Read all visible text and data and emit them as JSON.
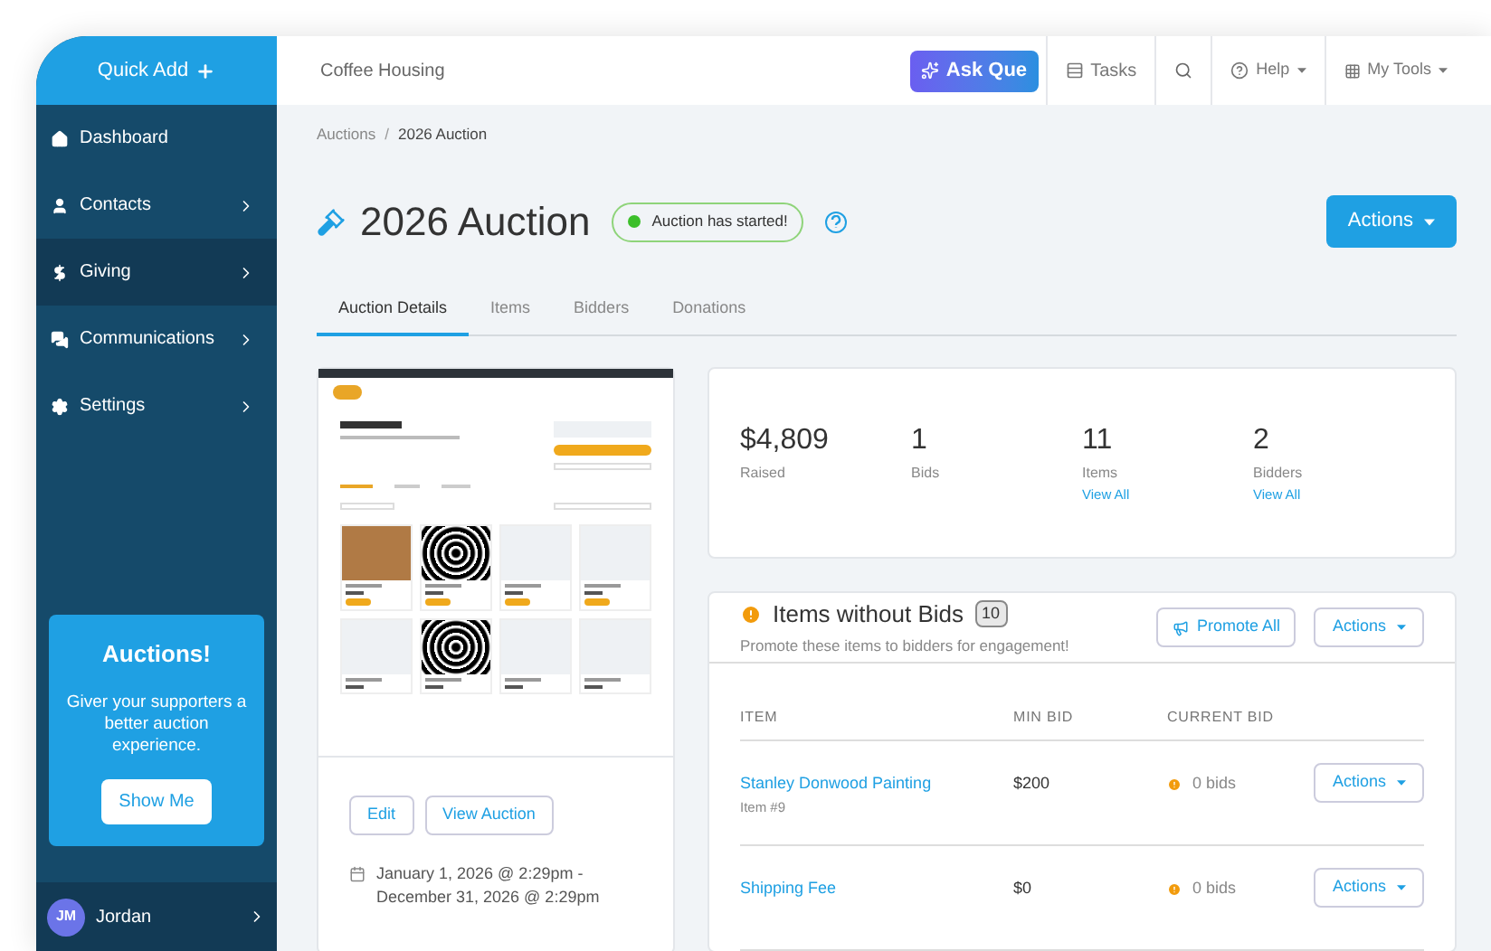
{
  "sidebar": {
    "quick_add": "Quick Add",
    "items": [
      {
        "label": "Dashboard",
        "expandable": false,
        "selected": false
      },
      {
        "label": "Contacts",
        "expandable": true,
        "selected": false
      },
      {
        "label": "Giving",
        "expandable": true,
        "selected": true
      },
      {
        "label": "Communications",
        "expandable": true,
        "selected": false
      },
      {
        "label": "Settings",
        "expandable": true,
        "selected": false
      }
    ],
    "promo": {
      "title": "Auctions!",
      "text": "Giver your supporters a better auction experience.",
      "button": "Show Me"
    },
    "user": {
      "initials": "JM",
      "name": "Jordan"
    }
  },
  "topbar": {
    "organization": "Coffee Housing",
    "ask_button": "Ask Que",
    "tasks": "Tasks",
    "help": "Help",
    "my_tools": "My Tools"
  },
  "breadcrumb": [
    "Auctions",
    "2026 Auction"
  ],
  "breadcrumb_separator": "/",
  "page": {
    "title": "2026 Auction",
    "status": "Auction has started!",
    "actions": "Actions"
  },
  "tabs": [
    {
      "label": "Auction Details",
      "selected": true
    },
    {
      "label": "Items",
      "selected": false
    },
    {
      "label": "Bidders",
      "selected": false
    },
    {
      "label": "Donations",
      "selected": false
    }
  ],
  "details": {
    "buttons": [
      "Edit",
      "View Auction"
    ],
    "dates": "January 1, 2026 @ 2:29pm - December 31, 2026 @ 2:29pm"
  },
  "stats": [
    {
      "value": "$4,809",
      "label": "Raised"
    },
    {
      "value": "1",
      "label": "Bids"
    },
    {
      "value": "11",
      "label": "Items",
      "link": "View All"
    },
    {
      "value": "2",
      "label": "Bidders",
      "link": "View All"
    }
  ],
  "items_without_bids": {
    "title": "Items without Bids",
    "count": "10",
    "subtitle": "Promote these items to bidders for engagement!",
    "promote": "Promote All",
    "actions": "Actions",
    "columns": [
      "ITEM",
      "MIN BID",
      "CURRENT BID"
    ],
    "rows": [
      {
        "name": "Stanley Donwood Painting",
        "sub": "Item #9",
        "min_bid": "$200",
        "current_bid": "0 bids",
        "action": "Actions"
      },
      {
        "name": "Shipping Fee",
        "min_bid": "$0",
        "current_bid": "0 bids",
        "action": "Actions"
      }
    ]
  }
}
